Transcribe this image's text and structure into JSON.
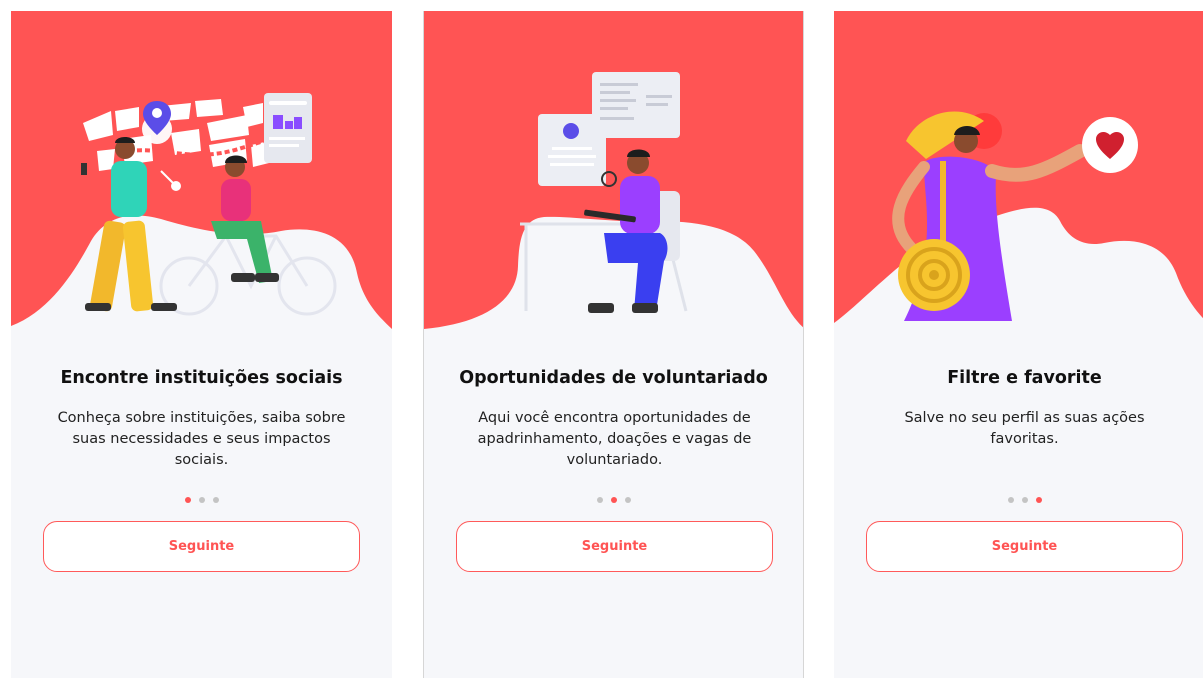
{
  "colors": {
    "accent": "#FF5454",
    "background": "#F6F7FA",
    "dot_inactive": "#C4C4C4"
  },
  "screens": [
    {
      "title": "Encontre instituições sociais",
      "description": "Conheça sobre instituições, saiba sobre suas necessidades e seus impactos sociais.",
      "active_dot": 0,
      "button_label": "Seguinte",
      "illustration": "people-walking-cycling-map"
    },
    {
      "title": "Oportunidades de voluntariado",
      "description": "Aqui você encontra oportunidades de apadrinhamento, doações e vagas de voluntariado.",
      "active_dot": 1,
      "button_label": "Seguinte",
      "illustration": "woman-at-desk-with-laptop"
    },
    {
      "title": "Filtre e favorite",
      "description": "Salve no seu perfil as suas ações favoritas.",
      "active_dot": 2,
      "button_label": "Seguinte",
      "illustration": "woman-pointing-at-heart"
    }
  ]
}
